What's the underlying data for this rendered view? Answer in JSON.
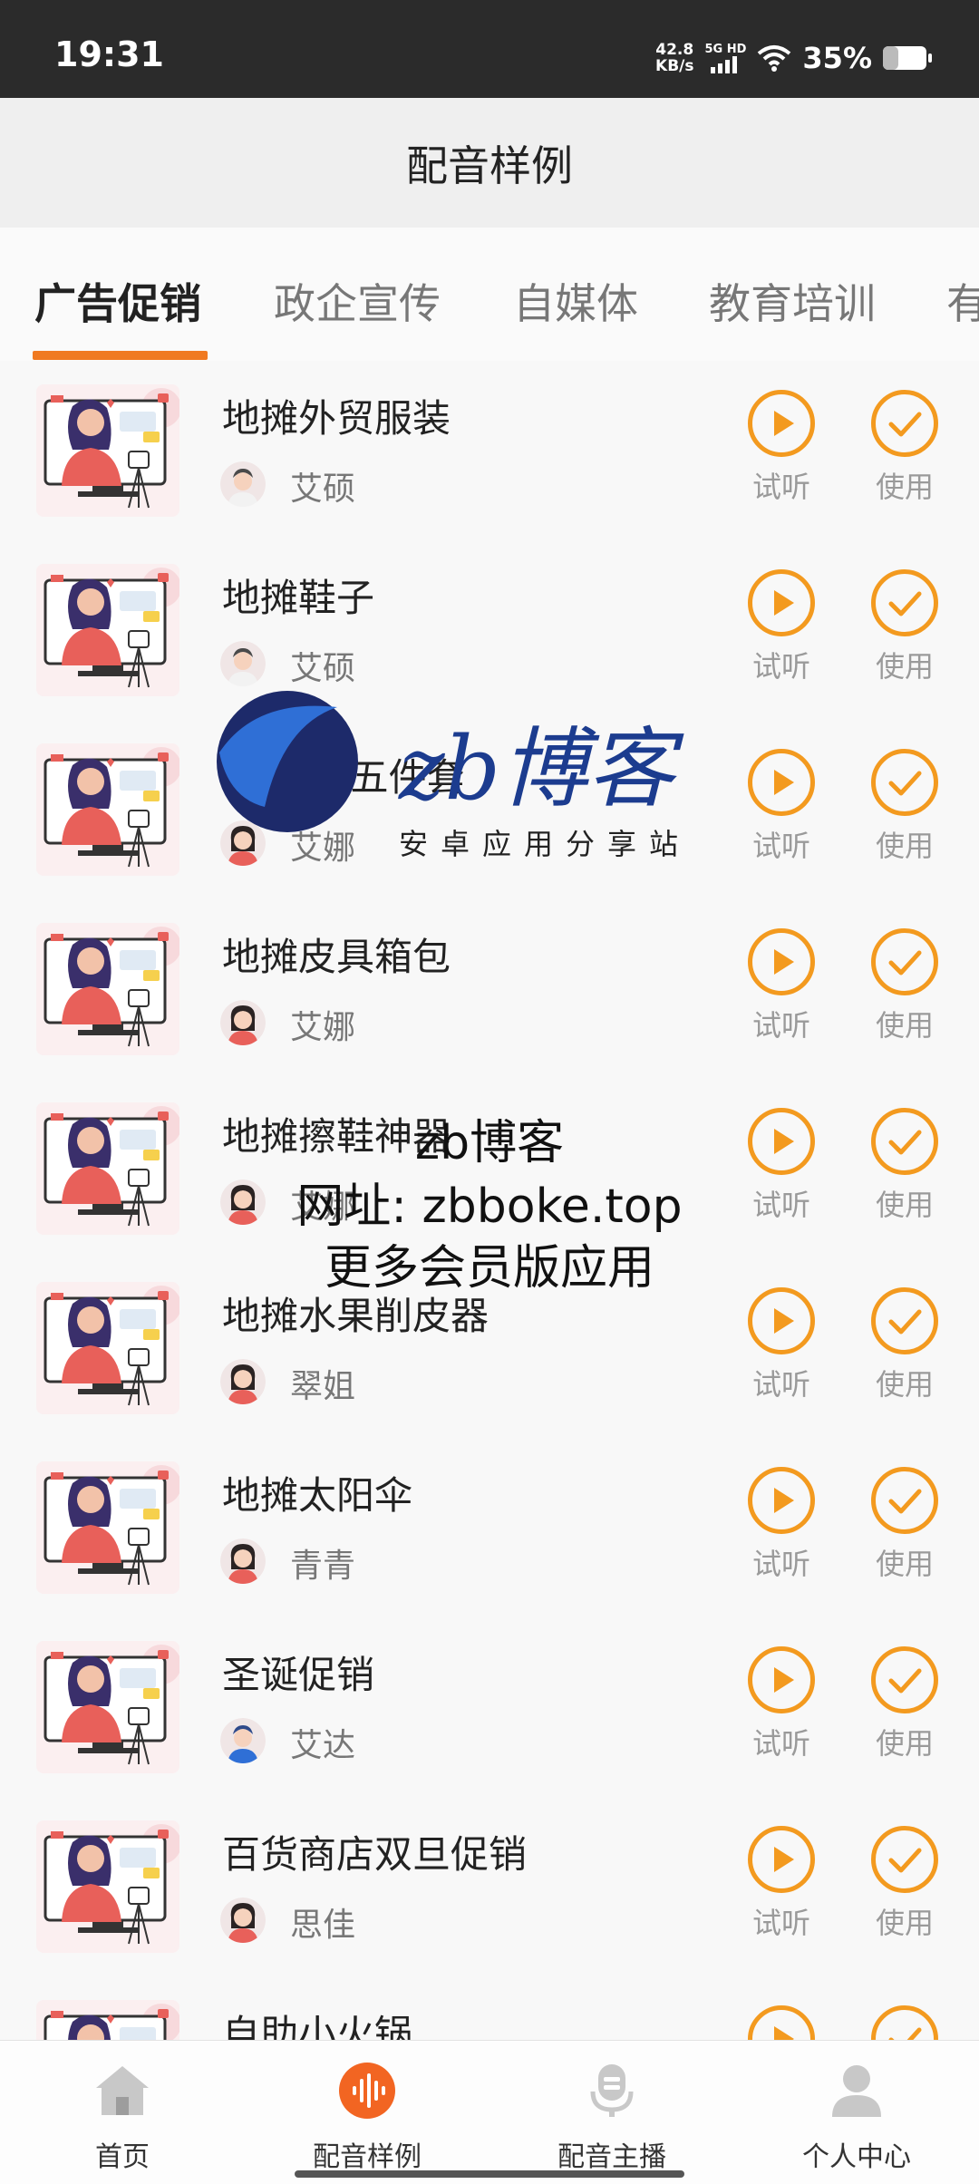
{
  "status_bar": {
    "time": "19:31",
    "net_speed_value": "42.8",
    "net_speed_unit": "KB/s",
    "signal_label": "5G HD",
    "battery_percent": "35%",
    "battery_level": 0.35
  },
  "header": {
    "title": "配音样例"
  },
  "tabs": [
    {
      "label": "广告促销",
      "active": true
    },
    {
      "label": "政企宣传",
      "active": false
    },
    {
      "label": "自媒体",
      "active": false
    },
    {
      "label": "教育培训",
      "active": false
    },
    {
      "label": "有",
      "active": false
    }
  ],
  "list": {
    "play_label": "试听",
    "use_label": "使用",
    "items": [
      {
        "title": "地摊外贸服装",
        "voice": "艾硕",
        "avatar": "male"
      },
      {
        "title": "地摊鞋子",
        "voice": "艾硕",
        "avatar": "male"
      },
      {
        "title": "地摊XX五件套",
        "voice": "艾娜",
        "avatar": "female"
      },
      {
        "title": "地摊皮具箱包",
        "voice": "艾娜",
        "avatar": "female"
      },
      {
        "title": "地摊擦鞋神器",
        "voice": "艾娜",
        "avatar": "female"
      },
      {
        "title": "地摊水果削皮器",
        "voice": "翠姐",
        "avatar": "female"
      },
      {
        "title": "地摊太阳伞",
        "voice": "青青",
        "avatar": "female2"
      },
      {
        "title": "圣诞促销",
        "voice": "艾达",
        "avatar": "male2"
      },
      {
        "title": "百货商店双旦促销",
        "voice": "思佳",
        "avatar": "female"
      },
      {
        "title": "自助小火锅",
        "voice": "",
        "avatar": "none"
      }
    ]
  },
  "watermark": {
    "logo_text": "zb博客",
    "logo_subtitle": "安卓应用分享站",
    "line1": "zb博客",
    "line2": "网址: zbboke.top",
    "line3": "更多会员版应用"
  },
  "bottom_nav": [
    {
      "label": "首页",
      "icon": "home-icon",
      "active": false
    },
    {
      "label": "配音样例",
      "icon": "audio-wave-icon",
      "active": true
    },
    {
      "label": "配音主播",
      "icon": "microphone-icon",
      "active": false
    },
    {
      "label": "个人中心",
      "icon": "person-icon",
      "active": false
    }
  ],
  "colors": {
    "accent": "#f39a1f",
    "tab_underline": "#f07a21",
    "active_nav": "#f26522"
  }
}
